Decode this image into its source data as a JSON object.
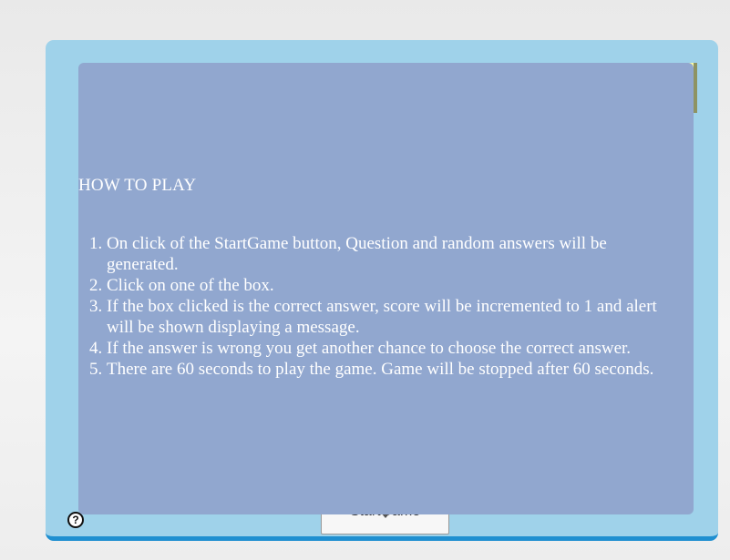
{
  "game": {
    "start_button_label": "StartGame",
    "help_icon_glyph": "?"
  },
  "instructions": {
    "title": "HOW TO PLAY",
    "steps": [
      "On click of the StartGame button, Question and random answers will be generated.",
      "Click on one of the box.",
      "If the box clicked is the correct answer, score will be incremented to 1 and alert will be shown displaying a message.",
      "If the answer is wrong you get another chance to choose the correct answer.",
      "There are 60 seconds to play the game. Game will be stopped after 60 seconds."
    ]
  },
  "colors": {
    "container_bg": "#9fd2ea",
    "container_border": "#1f8fd0",
    "overlay_bg": "#91a7cf",
    "score_box_bg": "#fbfba8"
  },
  "icons": {
    "help": "help-icon",
    "dropdown": "chevron-down-icon"
  }
}
